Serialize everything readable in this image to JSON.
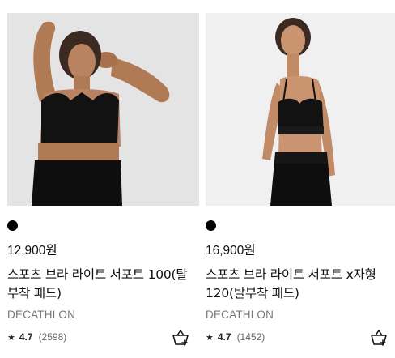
{
  "products": [
    {
      "image_alt": "product-photo",
      "swatch_color": "#000000",
      "price": "12,900원",
      "title": "스포츠 브라 라이트 서포트 100(탈부착 패드)",
      "brand": "DECATHLON",
      "rating": "4.7",
      "review_count": "(2598)"
    },
    {
      "image_alt": "product-photo",
      "swatch_color": "#000000",
      "price": "16,900원",
      "title": "스포츠 브라 라이트 서포트 x자형 120(탈부착 패드)",
      "brand": "DECATHLON",
      "rating": "4.7",
      "review_count": "(1452)"
    }
  ],
  "icons": {
    "star": "star-icon",
    "cart": "add-to-cart-icon"
  }
}
